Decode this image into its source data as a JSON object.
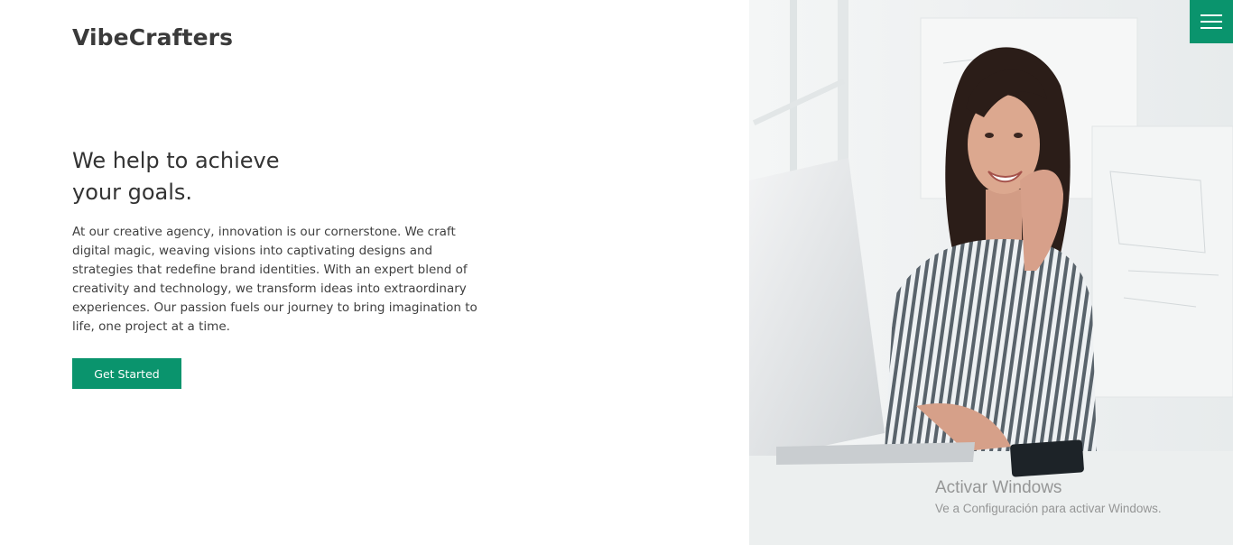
{
  "brand": {
    "name": "VibeCrafters",
    "accent_color": "#0a946d"
  },
  "hero": {
    "title_line1": "We help to achieve",
    "title_line2": "your goals.",
    "description": "At our creative agency, innovation is our cornerstone. We craft digital magic, weaving visions into captivating designs and strategies that redefine brand identities. With an expert blend of creativity and technology, we transform ideas into extraordinary experiences. Our passion fuels our journey to bring imagination to life, one project at a time.",
    "cta_label": "Get Started"
  },
  "menu": {
    "icon": "hamburger-menu-icon"
  },
  "image": {
    "subject": "smiling woman in striped shirt at laptop"
  },
  "os_watermark": {
    "title": "Activar Windows",
    "subtitle": "Ve a Configuración para activar Windows."
  }
}
